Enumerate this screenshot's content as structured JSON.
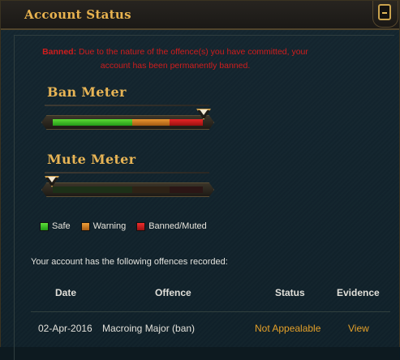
{
  "window": {
    "title": "Account Status"
  },
  "banned_message": {
    "prefix": "Banned:",
    "text": "Due to the nature of the offence(s) you have committed, your account has been permanently banned."
  },
  "ban_meter": {
    "title": "Ban Meter",
    "level": 1.0
  },
  "mute_meter": {
    "title": "Mute Meter",
    "level": 0.0
  },
  "legend": {
    "items": [
      {
        "label": "Safe",
        "color": "#3cc22a"
      },
      {
        "label": "Warning",
        "color": "#e38a28"
      },
      {
        "label": "Banned/Muted",
        "color": "#d81e1e"
      }
    ]
  },
  "offences": {
    "intro": "Your account has the following offences recorded:",
    "columns": [
      "Date",
      "Offence",
      "Status",
      "Evidence"
    ],
    "rows": [
      {
        "date": "02-Apr-2016",
        "offence": "Macroing Major (ban)",
        "status": "Not Appealable",
        "evidence": "View"
      }
    ]
  },
  "colors": {
    "accent_gold": "#e7b455",
    "banned_red": "#d11d1d",
    "status_orange": "#e4a029"
  }
}
